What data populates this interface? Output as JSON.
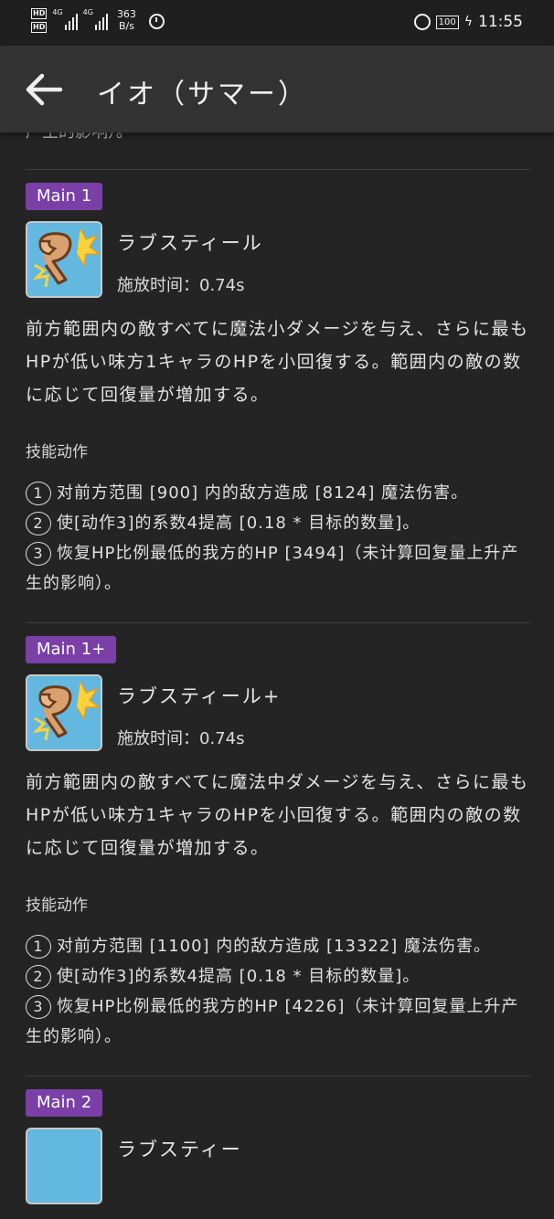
{
  "status_bar": {
    "hd1": "HD",
    "hd2": "HD",
    "net1": "4G",
    "net2": "4G",
    "speed_value": "363",
    "speed_unit": "B/s",
    "battery": "100",
    "time": "11:55"
  },
  "header": {
    "title": "イオ（サマー）"
  },
  "top_cut_text": "产生的影响）。",
  "skills": [
    {
      "badge": "Main 1",
      "name": "ラブスティール",
      "cast_time": "施放时间：0.74s",
      "description": "前方範囲内の敵すべてに魔法小ダメージを与え、さらに最もHPが低い味方1キャラのHPを小回復する。範囲内の敵の数に応じて回復量が増加する。",
      "section_label": "技能动作",
      "actions": [
        {
          "num": "1",
          "text": "对前方范围 [900] 内的敌方造成 [8124] 魔法伤害。"
        },
        {
          "num": "2",
          "text": "使[动作3]的系数4提高 [0.18 * 目标的数量]。"
        },
        {
          "num": "3",
          "text": "恢复HP比例最低的我方的HP [3494]（未计算回复量上升产生的影响）。"
        }
      ]
    },
    {
      "badge": "Main 1+",
      "name": "ラブスティール+",
      "cast_time": "施放时间：0.74s",
      "description": "前方範囲内の敵すべてに魔法中ダメージを与え、さらに最もHPが低い味方1キャラのHPを小回復する。範囲内の敵の数に応じて回復量が増加する。",
      "section_label": "技能动作",
      "actions": [
        {
          "num": "1",
          "text": "对前方范围 [1100] 内的敌方造成 [13322] 魔法伤害。"
        },
        {
          "num": "2",
          "text": "使[动作3]的系数4提高 [0.18 * 目标的数量]。"
        },
        {
          "num": "3",
          "text": "恢复HP比例最低的我方的HP [4226]（未计算回复量上升产生的影响）。"
        }
      ]
    }
  ],
  "next_badge": "Main 2",
  "next_name_partial": "ラブスティー"
}
